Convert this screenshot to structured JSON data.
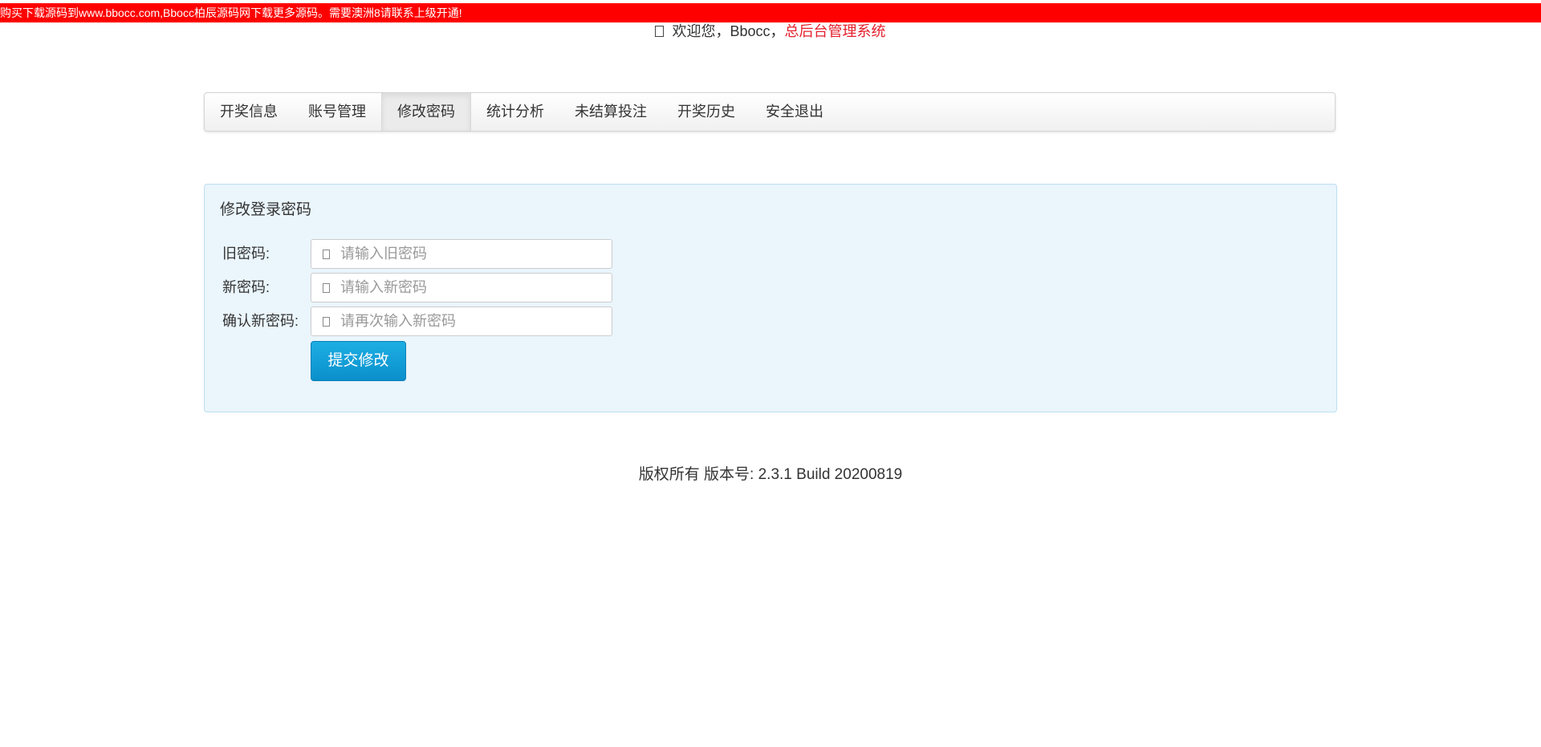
{
  "notice": {
    "text": "购买下载源码到www.bbocc.com,Bbocc柏辰源码网下载更多源码。需要澳洲8请联系上级开通!"
  },
  "header": {
    "welcome_prefix": "欢迎您，Bbocc，",
    "system_name": "总后台管理系统",
    "icon": "user-icon"
  },
  "nav": {
    "items": [
      {
        "label": "开奖信息",
        "active": false
      },
      {
        "label": "账号管理",
        "active": false
      },
      {
        "label": "修改密码",
        "active": true
      },
      {
        "label": "统计分析",
        "active": false
      },
      {
        "label": "未结算投注",
        "active": false
      },
      {
        "label": "开奖历史",
        "active": false
      },
      {
        "label": "安全退出",
        "active": false
      }
    ]
  },
  "form": {
    "title": "修改登录密码",
    "old_password": {
      "label": "旧密码:",
      "placeholder": "请输入旧密码",
      "value": "",
      "icon": "lock-icon"
    },
    "new_password": {
      "label": "新密码:",
      "placeholder": "请输入新密码",
      "value": "",
      "icon": "lock-icon"
    },
    "confirm_password": {
      "label": "确认新密码:",
      "placeholder": "请再次输入新密码",
      "value": "",
      "icon": "lock-icon"
    },
    "submit_label": "提交修改"
  },
  "footer": {
    "text": "版权所有 版本号: 2.3.1 Build 20200819"
  },
  "colors": {
    "notice_bg": "#ff0000",
    "system_name": "#e4202d",
    "panel_bg": "#eaf5fc",
    "button": "#0a8fcb"
  }
}
